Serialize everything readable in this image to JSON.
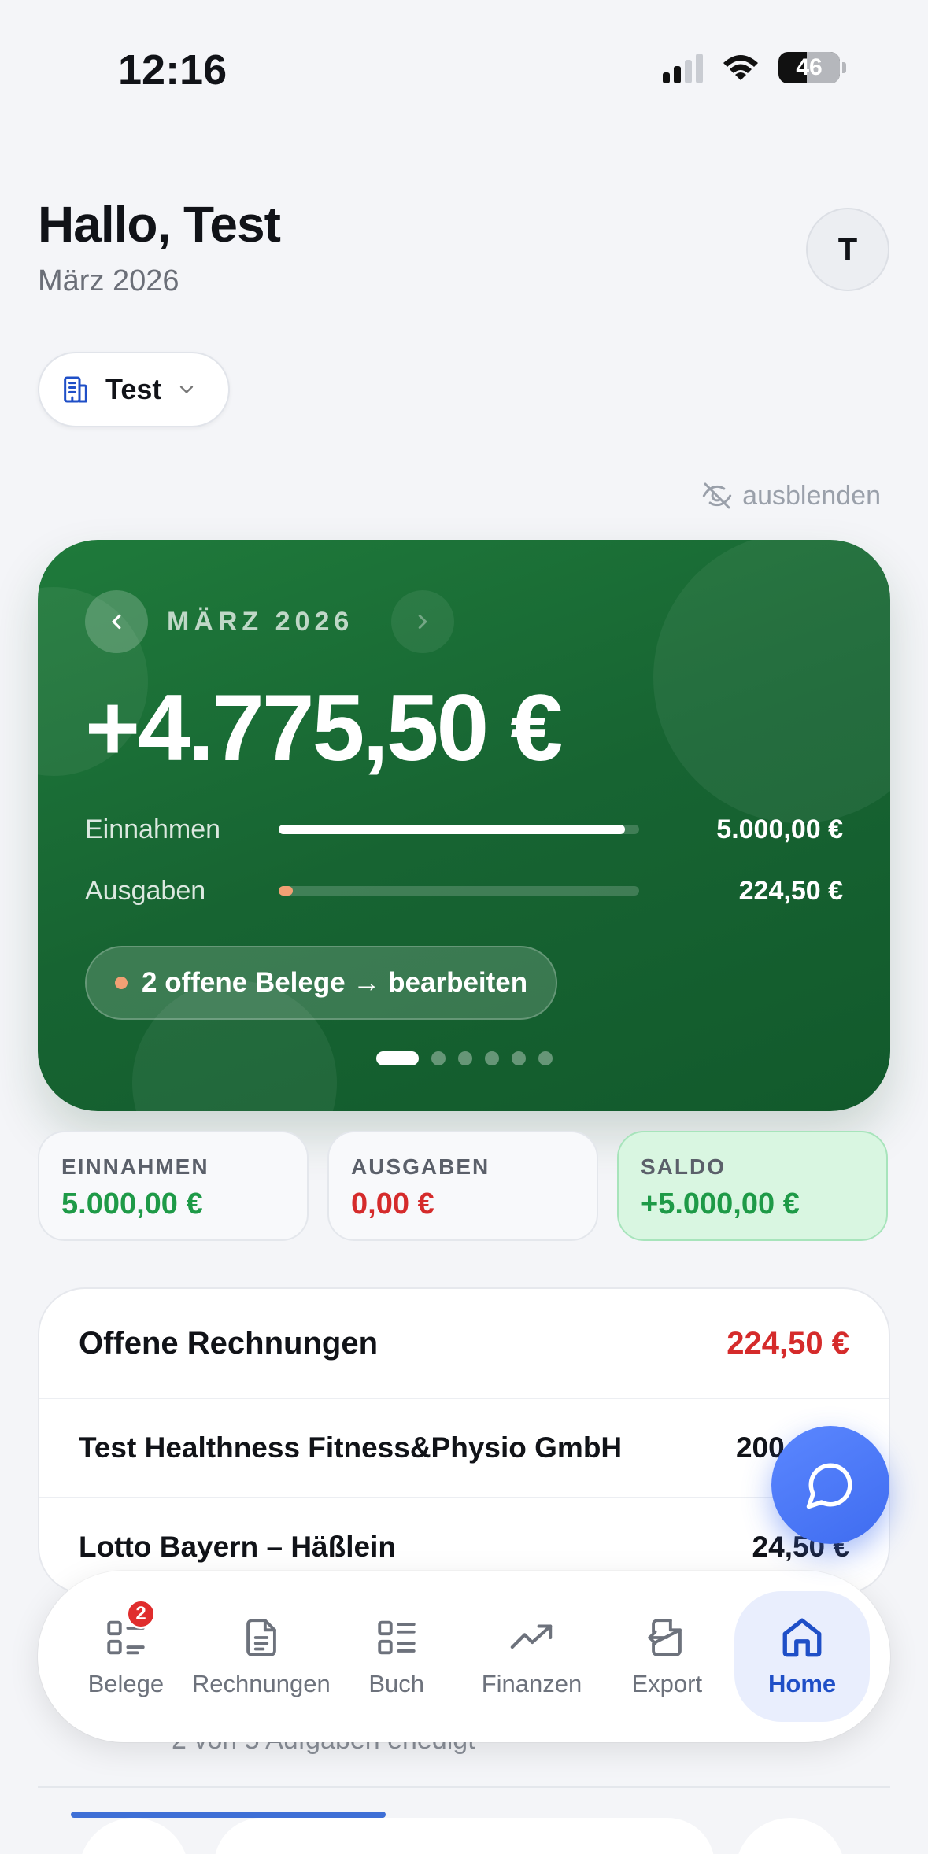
{
  "status_bar": {
    "time": "12:16",
    "battery": "46"
  },
  "header": {
    "greeting": "Hallo, Test",
    "month": "März 2026",
    "avatar_initial": "T"
  },
  "company_selector": {
    "label": "Test"
  },
  "hide_toggle": {
    "label": "ausblenden"
  },
  "hero": {
    "month": "MÄRZ 2026",
    "amount": "+4.775,50 €",
    "income_label": "Einnahmen",
    "income_value": "5.000,00 €",
    "income_fraction": 0.96,
    "expense_label": "Ausgaben",
    "expense_value": "224,50 €",
    "expense_fraction": 0.04,
    "receipts_action": "2 offene Belege → bearbeiten",
    "pager_active_index": 0,
    "pager_count": 6
  },
  "summary": [
    {
      "label": "EINNAHMEN",
      "value": "5.000,00 €",
      "color": "#1e9a47"
    },
    {
      "label": "AUSGABEN",
      "value": "0,00 €",
      "color": "#d52b2b"
    },
    {
      "label": "SALDO",
      "value": "+5.000,00 €",
      "color": "#1e9a47"
    }
  ],
  "open_invoices": {
    "title": "Offene Rechnungen",
    "total": "224,50 €",
    "rows": [
      {
        "name": "Test Healthness Fitness&Physio GmbH",
        "amount": "200,00 €"
      },
      {
        "name": "Lotto Bayern – Häßlein",
        "amount": "24,50 €"
      }
    ]
  },
  "tasks": {
    "progress_text": "2 von 5 Aufgaben erledigt"
  },
  "bottom_nav": [
    {
      "label": "Belege",
      "icon": "receipts-icon",
      "badge": "2"
    },
    {
      "label": "Rechnungen",
      "icon": "document-icon"
    },
    {
      "label": "Buch",
      "icon": "list-icon"
    },
    {
      "label": "Finanzen",
      "icon": "trending-up-icon"
    },
    {
      "label": "Export",
      "icon": "export-icon"
    },
    {
      "label": "Home",
      "icon": "home-icon",
      "active": true
    }
  ],
  "colors": {
    "hero_green": "#176432",
    "accent_blue": "#3f6cf0",
    "negative_red": "#d52b2b",
    "positive_green": "#1e9a47"
  }
}
